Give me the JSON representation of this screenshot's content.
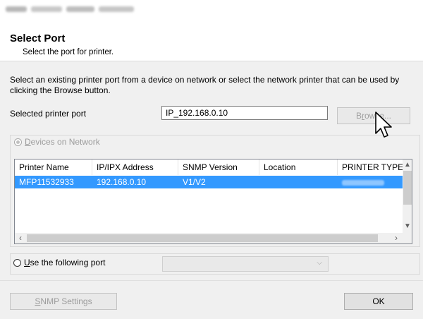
{
  "header": {
    "title": "Select Port",
    "subtitle": "Select the port for printer."
  },
  "instructions": "Select an existing printer port from a device on network or select the network printer that can be used by clicking the Browse button.",
  "selected_port": {
    "label": "Selected printer port",
    "value": "IP_192.168.0.10"
  },
  "browse_button": {
    "pre": "B",
    "accel": "r",
    "post": "owse..."
  },
  "devices_radio": {
    "accel": "D",
    "rest": "evices on Network",
    "checked": true
  },
  "device_list": {
    "columns": [
      "Printer Name",
      "IP/IPX Address",
      "SNMP Version",
      "Location",
      "PRINTER TYPE"
    ],
    "rows": [
      {
        "printer_name": "MFP11532933",
        "address": "192.168.0.10",
        "snmp_version": "V1/V2",
        "location": ""
      }
    ],
    "selected_row": 0
  },
  "use_port_radio": {
    "accel": "U",
    "rest": "se the following port",
    "checked": false
  },
  "port_select": {
    "value": ""
  },
  "footer": {
    "snmp_button": {
      "accel": "S",
      "rest": "NMP Settings"
    },
    "ok_label": "OK"
  },
  "colors": {
    "selection": "#3399ff",
    "dialog_bg": "#f0f0f0",
    "disabled_text": "#a0a0a0"
  }
}
